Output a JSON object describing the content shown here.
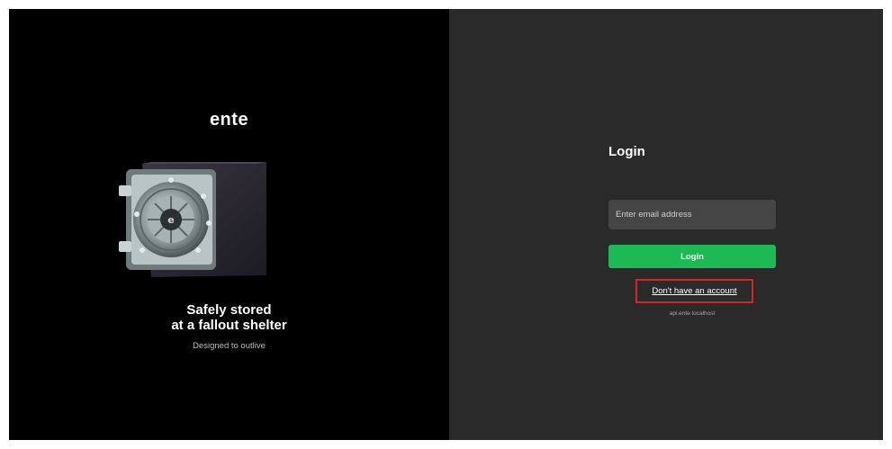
{
  "brand": {
    "logo_text": "ente"
  },
  "hero": {
    "image": "vault-illustration",
    "tagline_line1": "Safely stored",
    "tagline_line2": "at a fallout shelter",
    "subtagline": "Designed to outlive"
  },
  "login": {
    "title": "Login",
    "email_placeholder": "Enter email address",
    "email_value": "",
    "login_button_label": "Login",
    "signup_link_label": "Don't have an account",
    "api_host": "api.ente.localhost"
  },
  "colors": {
    "left_bg": "#000000",
    "right_bg": "#2a2a2a",
    "accent_green": "#1db954",
    "highlight_red": "#d02828"
  }
}
